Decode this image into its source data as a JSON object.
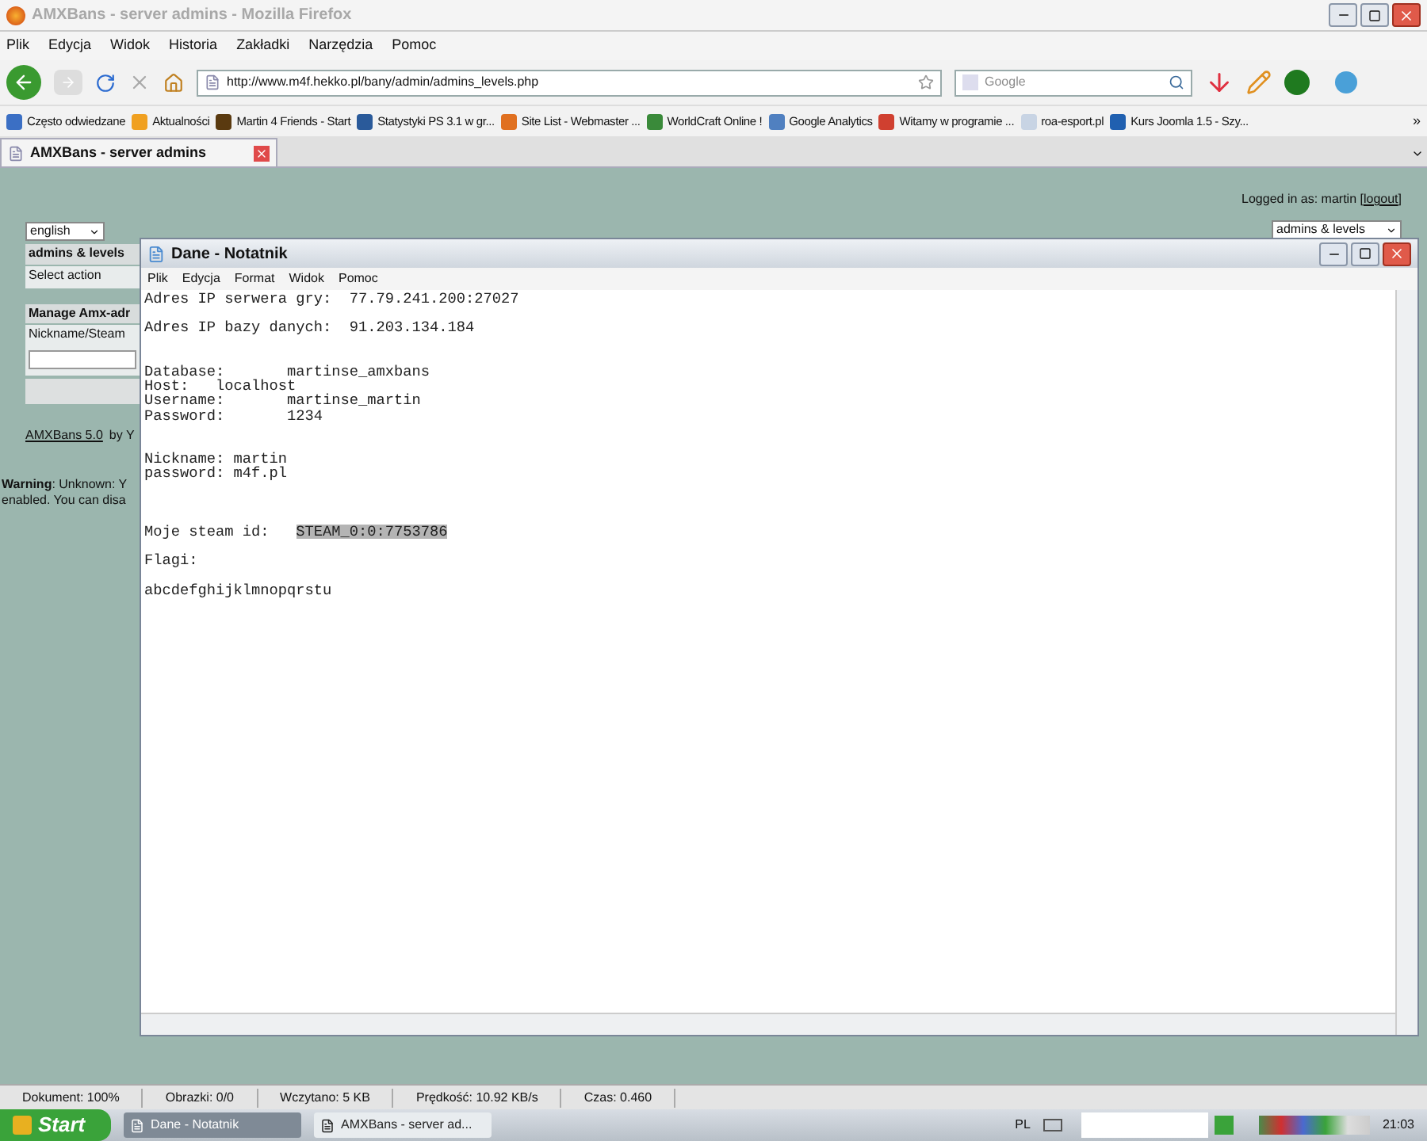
{
  "window": {
    "title": "AMXBans - server admins - Mozilla Firefox"
  },
  "menu": [
    "Plik",
    "Edycja",
    "Widok",
    "Historia",
    "Zakładki",
    "Narzędzia",
    "Pomoc"
  ],
  "toolbar": {
    "url": "http://www.m4f.hekko.pl/bany/admin/admins_levels.php",
    "search_placeholder": "Google"
  },
  "bookmarks": [
    {
      "label": "Często odwiedzane",
      "color": "#3b6fc4"
    },
    {
      "label": "Aktualności",
      "color": "#f0a020"
    },
    {
      "label": "Martin 4 Friends - Start",
      "color": "#5a3a10"
    },
    {
      "label": "Statystyki PS 3.1 w gr...",
      "color": "#2a5a9a"
    },
    {
      "label": "Site List - Webmaster ...",
      "color": "#e07020"
    },
    {
      "label": "WorldCraft Online !",
      "color": "#3a8a3a"
    },
    {
      "label": "Google Analytics",
      "color": "#5080c0"
    },
    {
      "label": "Witamy w programie ...",
      "color": "#d04030"
    },
    {
      "label": "roa-esport.pl",
      "color": "#c8d4e4"
    },
    {
      "label": "Kurs Joomla 1.5 - Szy...",
      "color": "#2060b0"
    }
  ],
  "bookmarks_overflow": "»",
  "tabs": [
    {
      "label": "AMXBans - server admins",
      "selected": true
    }
  ],
  "page": {
    "language": "english",
    "sidebar_title": "admins & levels",
    "sidebar_item": "Select action",
    "section_title": "Manage Amx-adr",
    "field_label": "Nickname/Steam",
    "footer_link": "AMXBans 5.0",
    "footer_text": "by Y",
    "warning_lines": [
      "**Warning**: Unknown: Y",
      "enabled. You can disa"
    ],
    "login_text": "Logged in as: martin [",
    "logout": "logout",
    "login_end": "]",
    "section_select": "admins & levels"
  },
  "notepad": {
    "title": "Dane - Notatnik",
    "menu": [
      "Plik",
      "Edycja",
      "Format",
      "Widok",
      "Pomoc"
    ],
    "lines": [
      {
        "kind": "text",
        "segments": [
          {
            "text": "Adres IP serwera gry:  77.79.241.200:27027",
            "selected": false
          }
        ]
      },
      {
        "kind": "blank"
      },
      {
        "kind": "text",
        "segments": [
          {
            "text": "Adres IP bazy danych:  91.203.134.184",
            "selected": false
          }
        ]
      },
      {
        "kind": "blank"
      },
      {
        "kind": "blank"
      },
      {
        "kind": "text",
        "segments": [
          {
            "text": "Database:       martinse_amxbans",
            "selected": false
          }
        ]
      },
      {
        "kind": "text",
        "segments": [
          {
            "text": "Host:   localhost",
            "selected": false
          }
        ]
      },
      {
        "kind": "text",
        "segments": [
          {
            "text": "Username:       martinse_martin",
            "selected": false
          }
        ]
      },
      {
        "kind": "text",
        "segments": [
          {
            "text": "Password:       1234",
            "selected": false
          }
        ]
      },
      {
        "kind": "blank"
      },
      {
        "kind": "blank"
      },
      {
        "kind": "text",
        "segments": [
          {
            "text": "Nickname: martin",
            "selected": false
          }
        ]
      },
      {
        "kind": "text",
        "segments": [
          {
            "text": "password: m4f.pl",
            "selected": false
          }
        ]
      },
      {
        "kind": "blank"
      },
      {
        "kind": "blank"
      },
      {
        "kind": "blank"
      },
      {
        "kind": "text",
        "segments": [
          {
            "text": "Moje steam id:   ",
            "selected": false
          },
          {
            "text": "STEAM_0:0:7753786",
            "selected": true
          }
        ]
      },
      {
        "kind": "blank"
      },
      {
        "kind": "text",
        "segments": [
          {
            "text": "Flagi:",
            "selected": false
          }
        ]
      },
      {
        "kind": "blank"
      },
      {
        "kind": "text",
        "segments": [
          {
            "text": "abcdefghijklmnopqrstu",
            "selected": false
          }
        ]
      }
    ]
  },
  "status_bar": [
    "Dokument: 100%",
    "Obrazki: 0/0",
    "Wczytano: 5 KB",
    "Prędkość: 10.92 KB/s",
    "Czas: 0.460"
  ],
  "taskbar": {
    "start": "Start",
    "tasks": [
      {
        "label": "Dane - Notatnik",
        "selected": true
      },
      {
        "label": "AMXBans - server ad...",
        "selected": false
      }
    ],
    "language": "PL",
    "clock": "21:03"
  }
}
